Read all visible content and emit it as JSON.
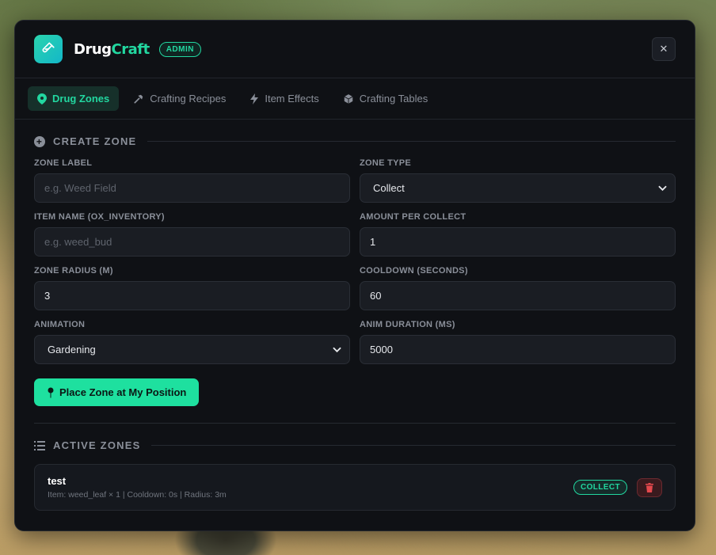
{
  "header": {
    "brand_part1": "Drug",
    "brand_part2": "Craft",
    "badge": "ADMIN",
    "close_label": "✕"
  },
  "tabs": [
    {
      "label": "Drug Zones",
      "icon": "map-pin-icon",
      "active": true
    },
    {
      "label": "Crafting Recipes",
      "icon": "hammer-icon",
      "active": false
    },
    {
      "label": "Item Effects",
      "icon": "bolt-icon",
      "active": false
    },
    {
      "label": "Crafting Tables",
      "icon": "cube-icon",
      "active": false
    }
  ],
  "create_zone": {
    "title": "CREATE ZONE",
    "zone_label": {
      "label": "ZONE LABEL",
      "placeholder": "e.g. Weed Field",
      "value": ""
    },
    "zone_type": {
      "label": "ZONE TYPE",
      "value": "Collect"
    },
    "item_name": {
      "label": "ITEM NAME (OX_INVENTORY)",
      "placeholder": "e.g. weed_bud",
      "value": ""
    },
    "amount_per_collect": {
      "label": "AMOUNT PER COLLECT",
      "value": "1"
    },
    "zone_radius": {
      "label": "ZONE RADIUS (M)",
      "value": "3"
    },
    "cooldown": {
      "label": "COOLDOWN (SECONDS)",
      "value": "60"
    },
    "animation": {
      "label": "ANIMATION",
      "value": "Gardening"
    },
    "anim_duration": {
      "label": "ANIM DURATION (MS)",
      "value": "5000"
    },
    "place_button": "Place Zone at My Position"
  },
  "active_zones": {
    "title": "ACTIVE ZONES",
    "items": [
      {
        "name": "test",
        "meta": "Item: weed_leaf × 1 | Cooldown: 0s | Radius: 3m",
        "type_badge": "COLLECT"
      }
    ]
  },
  "colors": {
    "accent": "#22d7a0",
    "panel_bg": "#0f1115",
    "danger": "#e5484d"
  }
}
